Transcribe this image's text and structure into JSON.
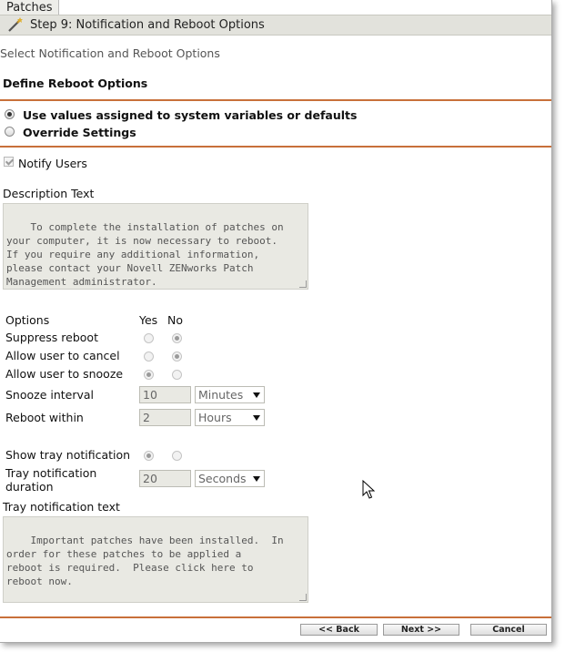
{
  "tab": {
    "label": "Patches"
  },
  "step": {
    "title": "Step 9: Notification and Reboot Options"
  },
  "subtitle": "Select Notification and Reboot Options",
  "section": {
    "title": "Define Reboot Options"
  },
  "mode": {
    "option1": "Use values assigned to system variables or defaults",
    "option2": "Override Settings",
    "selected": "option1"
  },
  "notify": {
    "label": "Notify Users",
    "checked": true
  },
  "description": {
    "label": "Description Text",
    "text": "To complete the installation of patches on\nyour computer, it is now necessary to reboot.\nIf you require any additional information,\nplease contact your Novell ZENworks Patch\nManagement administrator."
  },
  "options": {
    "header": "Options",
    "yes": "Yes",
    "no": "No",
    "rows": [
      {
        "label": "Suppress reboot",
        "value": "no"
      },
      {
        "label": "Allow user to cancel",
        "value": "no"
      },
      {
        "label": "Allow user to snooze",
        "value": "yes"
      }
    ]
  },
  "snooze": {
    "label": "Snooze interval",
    "value": "10",
    "unit": "Minutes"
  },
  "reboot": {
    "label": "Reboot within",
    "value": "2",
    "unit": "Hours"
  },
  "tray": {
    "show_label": "Show tray notification",
    "show_value": "yes",
    "duration_label_1": "Tray notification",
    "duration_label_2": "duration",
    "duration_value": "20",
    "duration_unit": "Seconds",
    "text_label": "Tray notification text",
    "text": "Important patches have been installed.  In\norder for these patches to be applied a\nreboot is required.  Please click here to\nreboot now."
  },
  "buttons": {
    "back": "<< Back",
    "next": "Next >>",
    "cancel": "Cancel"
  },
  "colors": {
    "divider": "#c8703a",
    "header_bg": "#e2e2dc"
  }
}
